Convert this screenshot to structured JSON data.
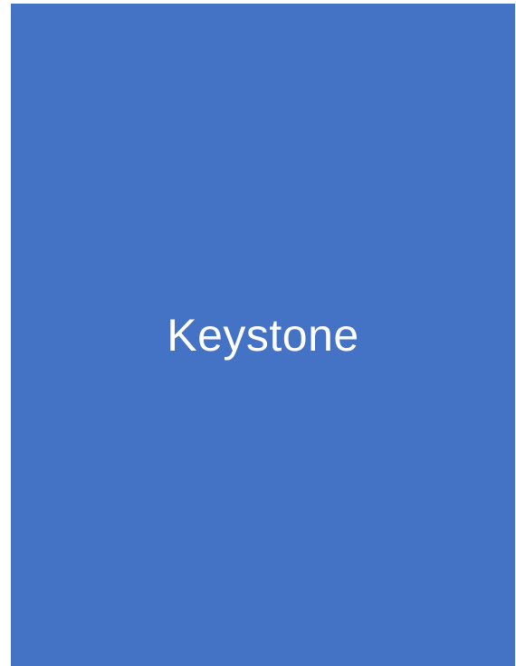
{
  "block": {
    "label": "Keystone",
    "fill_color": "#4472C4",
    "text_color": "#FFFFFF"
  }
}
